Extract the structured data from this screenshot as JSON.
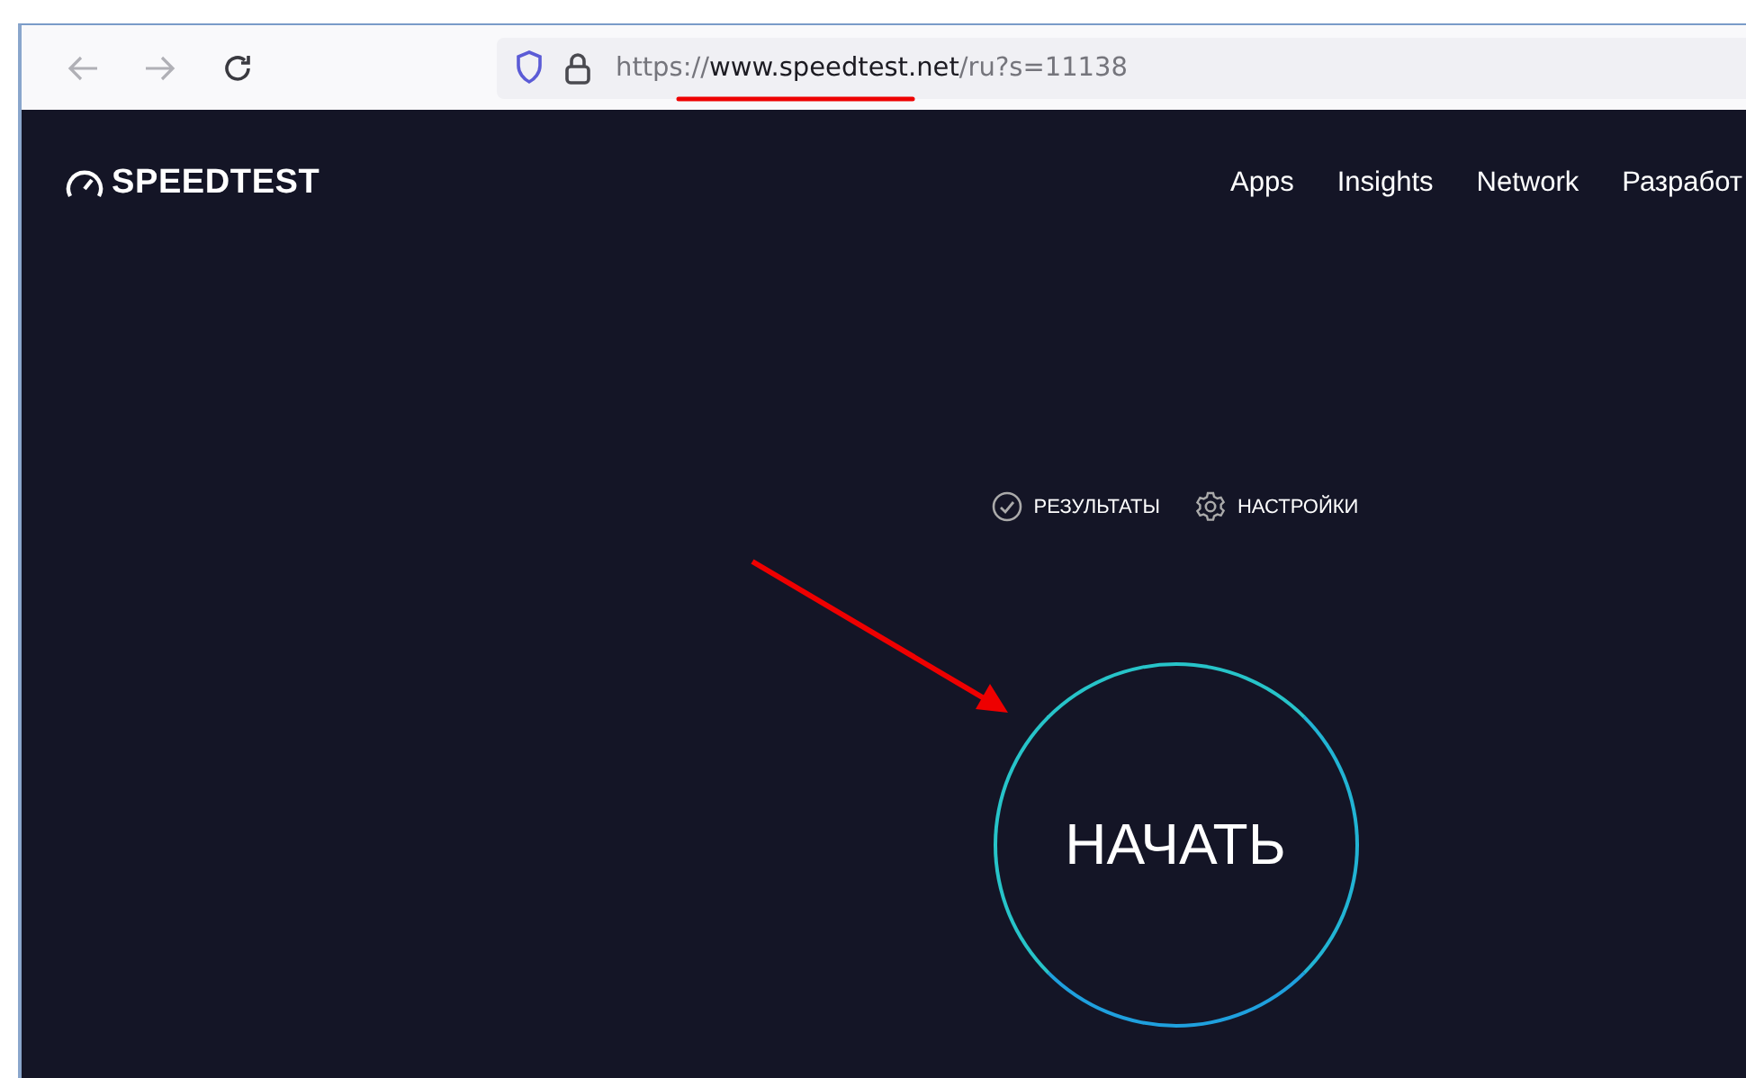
{
  "browser": {
    "url_prefix": "https://",
    "url_domain": "www.speedtest.net",
    "url_suffix": "/ru?s=11138",
    "secure": true
  },
  "site": {
    "logo": "SPEEDTEST",
    "nav": [
      "Apps",
      "Insights",
      "Network",
      "Разработ"
    ]
  },
  "test_links": [
    {
      "label": "РЕЗУЛЬТАТЫ",
      "kind": "results"
    },
    {
      "label": "НАСТРОЙКИ",
      "kind": "settings"
    }
  ],
  "start_button": {
    "label": "НАЧАТЬ"
  },
  "annotations": {
    "url_underline": true,
    "arrow_to_start": true
  }
}
